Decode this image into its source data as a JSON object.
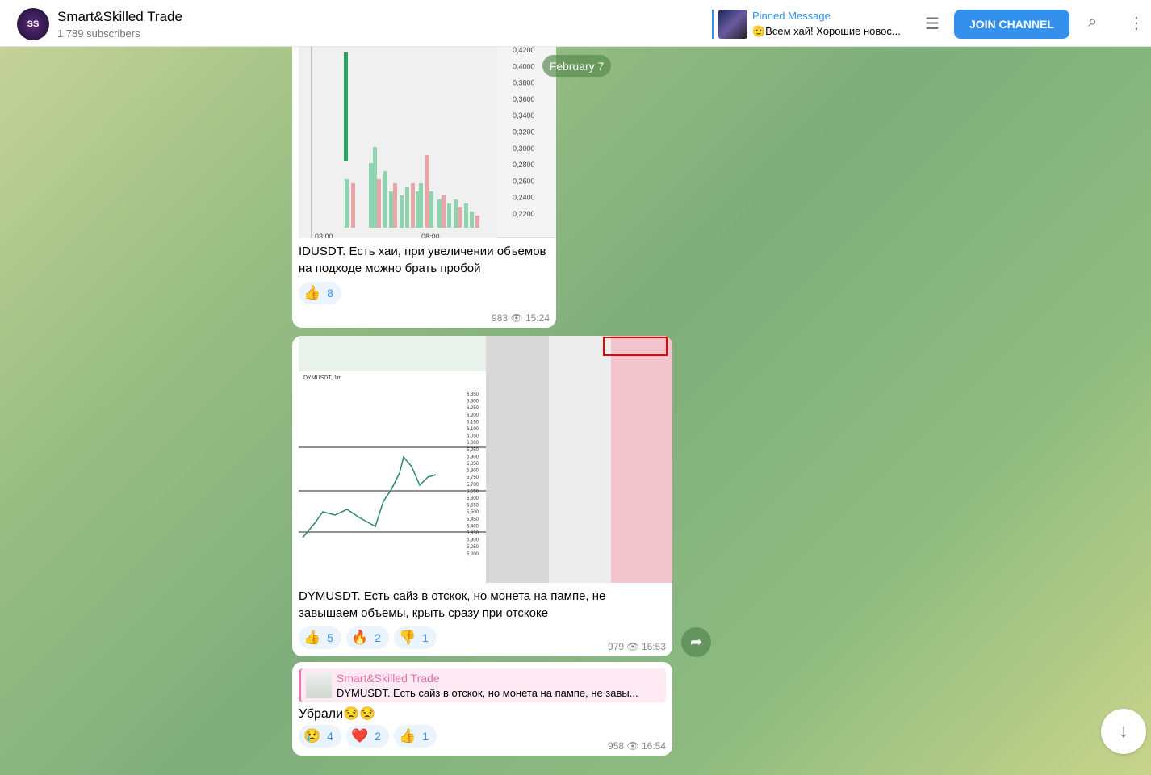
{
  "header": {
    "title": "Smart&Skilled Trade",
    "subscribers": "1 789 subscribers",
    "avatar_text": "SS",
    "pinned": {
      "label": "Pinned Message",
      "text": "🫡Всем хай! Хорошие новос..."
    },
    "join_label": "JOIN CHANNEL"
  },
  "date_pill": "February 7",
  "messages": [
    {
      "chart_price_labels": [
        "0,4200",
        "0,4000",
        "0,3800",
        "0,3600",
        "0,3400",
        "0,3200",
        "0,3000",
        "0,2800",
        "0,2600",
        "0,2400",
        "0,2200"
      ],
      "chart_time_labels": [
        "03:00",
        "08:00"
      ],
      "caption": "IDUSDT. Есть хаи, при увеличении объемов на подходе можно брать пробой",
      "reactions": [
        {
          "emoji": "👍",
          "count": "8"
        }
      ],
      "views": "983",
      "time": "15:24"
    },
    {
      "chart_symbol": "DYMUSDT, 1m",
      "chart_price_labels": [
        "6,350",
        "6,300",
        "6,250",
        "6,200",
        "6,150",
        "6,100",
        "6,050",
        "6,000",
        "5,950",
        "5,900",
        "5,850",
        "5,800",
        "5,750",
        "5,700",
        "5,650",
        "5,600",
        "5,550",
        "5,500",
        "5,450",
        "5,400",
        "5,350",
        "5,300",
        "5,250",
        "5,200"
      ],
      "caption": "DYMUSDT. Есть сайз в отскок, но монета на пампе, не завышаем объемы, крыть сразу при отскоке",
      "reactions": [
        {
          "emoji": "👍",
          "count": "5"
        },
        {
          "emoji": "🔥",
          "count": "2"
        },
        {
          "emoji": "👎",
          "count": "1"
        }
      ],
      "views": "979",
      "time": "16:53"
    },
    {
      "reply": {
        "name": "Smart&Skilled Trade",
        "text": "DYMUSDT. Есть сайз в отскок, но монета на пампе, не завы..."
      },
      "text": "Убрали😒😒",
      "reactions": [
        {
          "emoji": "😢",
          "count": "4"
        },
        {
          "emoji": "❤️",
          "count": "2"
        },
        {
          "emoji": "👍",
          "count": "1"
        }
      ],
      "views": "958",
      "time": "16:54"
    }
  ],
  "colors": {
    "accent": "#3390ec",
    "reply_name": "#e56ea8"
  }
}
